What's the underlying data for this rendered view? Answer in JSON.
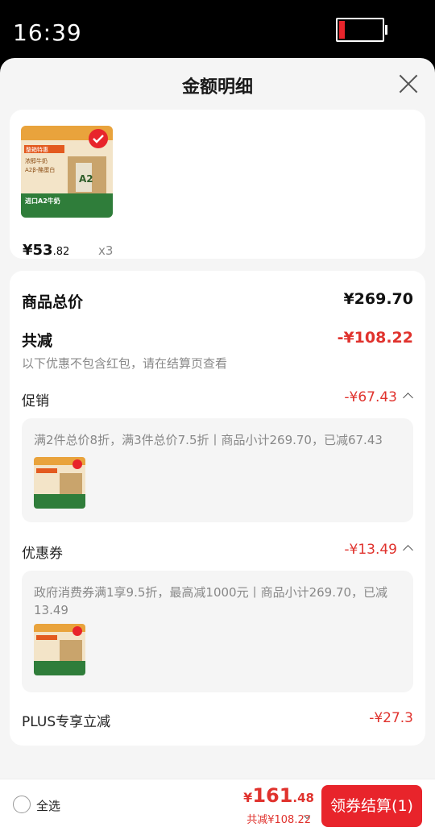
{
  "status_bar": {
    "time": "16:39",
    "battery_level": 0.12
  },
  "sheet": {
    "title": "金额明细"
  },
  "product": {
    "price_int": "¥53",
    "price_dec": ".82",
    "qty": "x3",
    "image_badge": "整箱特惠",
    "image_lines": [
      "浓醇牛奶",
      "A2β-酪蛋白",
      "进口A2牛奶"
    ],
    "image_carton": "A2"
  },
  "summary": {
    "total_label": "商品总价",
    "total_value": "¥269.70",
    "reduce_label": "共减",
    "reduce_value": "-¥108.22",
    "hint": "以下优惠不包含红包，请在结算页查看"
  },
  "promo": {
    "label": "促销",
    "value": "-¥67.43",
    "detail": "满2件总价8折，满3件总价7.5折丨商品小计269.70，已减67.43"
  },
  "coupon": {
    "label": "优惠券",
    "value": "-¥13.49",
    "detail": "政府消费券满1享9.5折，最高减1000元丨商品小计269.70，已减13.49"
  },
  "plus": {
    "label": "PLUS专享立减",
    "value": "-¥27.3"
  },
  "bottom": {
    "select_all": "全选",
    "total_sym": "¥",
    "total_int": "161",
    "total_dec": ".48",
    "saved": "共减¥108.22",
    "checkout": "领券结算(1)"
  },
  "colors": {
    "accent": "#e8242b",
    "discount": "#e0322d",
    "sheet_bg": "#f5f5f5"
  }
}
